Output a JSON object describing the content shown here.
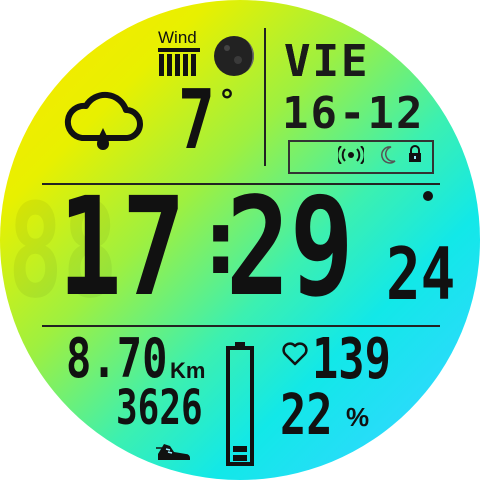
{
  "weather": {
    "wind_label": "Wind",
    "temperature": "7",
    "temperature_unit": "°"
  },
  "date": {
    "weekday": "VIE",
    "day_month": "16-12"
  },
  "time": {
    "hours": "17",
    "separator": ":",
    "minutes": "29",
    "seconds": "24"
  },
  "stats": {
    "distance": "8.70",
    "distance_unit": "Km",
    "steps": "3626",
    "heart_rate": "139",
    "battery_percent": "22",
    "percent_sign": "%"
  },
  "battery_level": 0.22,
  "wind_bars": 5,
  "colors": {
    "gradient_start": "#ffe500",
    "gradient_mid": "#3cf0b0",
    "gradient_end": "#58c8ff",
    "digit": "#111111"
  },
  "icons": [
    "cloud-rain-icon",
    "moon-phase-icon",
    "wind-bars-icon",
    "nfc-icon",
    "night-mode-icon",
    "lock-icon",
    "heart-icon",
    "battery-icon",
    "shoe-icon"
  ]
}
